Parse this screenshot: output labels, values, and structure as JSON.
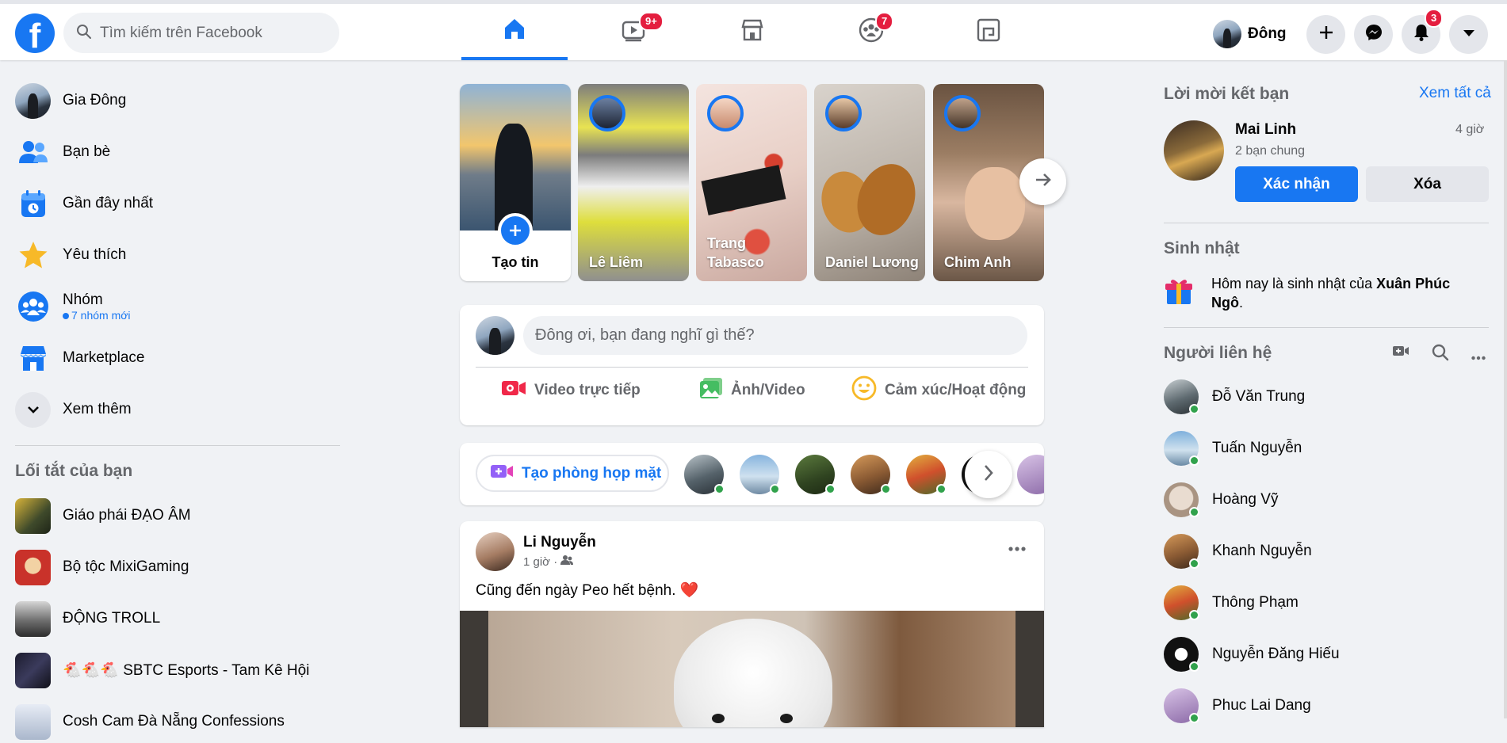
{
  "header": {
    "logo": "f",
    "search_placeholder": "Tìm kiếm trên Facebook",
    "nav": [
      {
        "name": "home",
        "badge": ""
      },
      {
        "name": "watch",
        "badge": "9+"
      },
      {
        "name": "marketplace",
        "badge": ""
      },
      {
        "name": "groups",
        "badge": "7"
      },
      {
        "name": "gaming",
        "badge": ""
      }
    ],
    "profile_name": "Đông",
    "notifications_badge": "3"
  },
  "sidebar": {
    "items": [
      {
        "label": "Gia Đông",
        "icon": "profile-avatar"
      },
      {
        "label": "Bạn bè",
        "icon": "friends-icon"
      },
      {
        "label": "Gần đây nhất",
        "icon": "recent-icon"
      },
      {
        "label": "Yêu thích",
        "icon": "star-icon"
      },
      {
        "label": "Nhóm",
        "icon": "groups-icon",
        "sub": "7 nhóm mới"
      },
      {
        "label": "Marketplace",
        "icon": "store-icon"
      },
      {
        "label": "Xem thêm",
        "icon": "chevron-down-icon"
      }
    ],
    "shortcuts_title": "Lối tắt của bạn",
    "shortcuts": [
      {
        "label": "Giáo phái ĐẠO ÂM"
      },
      {
        "label": "Bộ tộc MixiGaming"
      },
      {
        "label": "ĐỘNG TROLL"
      },
      {
        "label": "🐔🐔🐔 SBTC Esports - Tam Kê Hội"
      },
      {
        "label": "Cosh Cam Đà Nẵng Confessions"
      }
    ]
  },
  "stories": {
    "create_label": "Tạo tin",
    "items": [
      {
        "name": "Lê Liêm"
      },
      {
        "name": "Trang Tabasco"
      },
      {
        "name": "Daniel Lương"
      },
      {
        "name": "Chim Anh"
      }
    ]
  },
  "composer": {
    "placeholder": "Đông ơi, bạn đang nghĩ gì thế?",
    "actions": [
      "Video trực tiếp",
      "Ảnh/Video",
      "Cảm xúc/Hoạt động"
    ]
  },
  "rooms": {
    "create_label": "Tạo phòng họp mặt"
  },
  "post": {
    "author": "Li Nguyễn",
    "time": "1 giờ ·",
    "text": "Cũng đến ngày Peo hết bệnh. ❤️"
  },
  "friend_requests": {
    "title": "Lời mời kết bạn",
    "see_all": "Xem tất cả",
    "name": "Mai Linh",
    "time": "4 giờ",
    "mutual": "2 bạn chung",
    "confirm": "Xác nhận",
    "delete": "Xóa"
  },
  "birthdays": {
    "title": "Sinh nhật",
    "text_prefix": "Hôm nay là sinh nhật của ",
    "name": "Xuân Phúc Ngô",
    "text_suffix": "."
  },
  "contacts": {
    "title": "Người liên hệ",
    "items": [
      {
        "name": "Đỗ Văn Trung"
      },
      {
        "name": "Tuấn Nguyễn"
      },
      {
        "name": "Hoàng Vỹ"
      },
      {
        "name": "Khanh Nguyễn"
      },
      {
        "name": "Thông Phạm"
      },
      {
        "name": "Nguyễn Đăng Hiếu"
      },
      {
        "name": "Phuc Lai Dang"
      }
    ]
  },
  "colors": {
    "brand": "#1877f2",
    "badge": "#e41e3f",
    "online": "#31a24c"
  }
}
